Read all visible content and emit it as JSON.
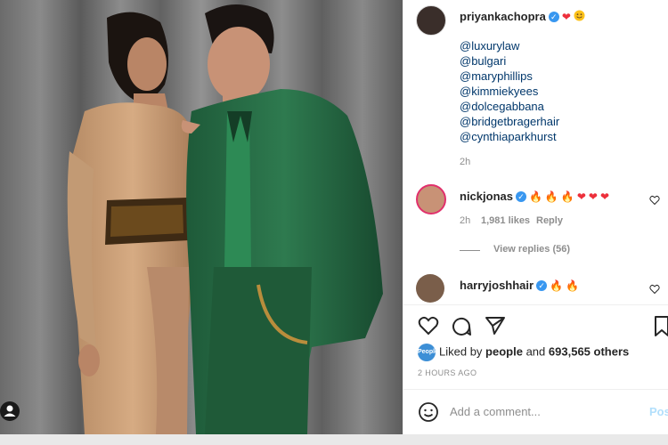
{
  "post": {
    "author": "priyankachopra",
    "caption_mentions": [
      "@luxurylaw",
      "@bulgari",
      "@maryphillips",
      "@kimmiekyees",
      "@dolcegabbana",
      "@bridgetbragerhair",
      "@cynthiaparkhurst"
    ],
    "time": "2h"
  },
  "comments": [
    {
      "user": "nickjonas",
      "time": "2h",
      "likes": "1,981 likes",
      "reply": "Reply",
      "view_replies": "View replies (56)"
    },
    {
      "user": "harryjoshhair"
    }
  ],
  "likes": {
    "badge": "People",
    "prefix": "Liked by",
    "user": "people",
    "and": "and",
    "count": "693,565 others"
  },
  "posted_ago": "2 HOURS AGO",
  "comment_input": {
    "placeholder": "Add a comment..."
  },
  "post_button": "Pos",
  "colors": {
    "verified": "#3897f0",
    "heart": "#ed2f3b",
    "link": "#00376b",
    "secondary": "#8e8e8e"
  }
}
